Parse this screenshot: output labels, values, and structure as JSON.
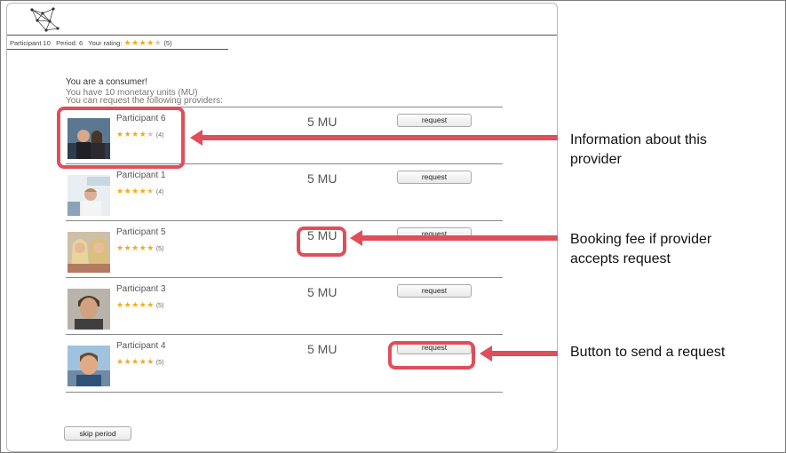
{
  "status": {
    "participant": "Participant 10",
    "period": "Period: 6",
    "rating_label": "Your rating:",
    "rating_stars": 4,
    "rating_count": "(5)"
  },
  "intro": {
    "line1": "You are a consumer!",
    "line2": "You have 10 monetary units (MU)",
    "line3": "You can request the following providers:"
  },
  "providers": [
    {
      "name": "Participant 6",
      "rating": 4,
      "count": "(4)",
      "price": "5 MU",
      "button": "request"
    },
    {
      "name": "Participant 1",
      "rating": 4.5,
      "count": "(4)",
      "price": "5 MU",
      "button": "request"
    },
    {
      "name": "Participant 5",
      "rating": 5,
      "count": "(5)",
      "price": "5 MU",
      "button": "request"
    },
    {
      "name": "Participant 3",
      "rating": 5,
      "count": "(5)",
      "price": "5 MU",
      "button": "request"
    },
    {
      "name": "Participant 4",
      "rating": 5,
      "count": "(5)",
      "price": "5 MU",
      "button": "request"
    }
  ],
  "skip_button": "skip period",
  "annotations": {
    "info": "Information about this\nprovider",
    "fee": "Booking fee if provider\naccepts request",
    "button": "Button to send a request"
  },
  "colors": {
    "highlight": "#e04e5a",
    "star": "#f0ad19"
  },
  "icons": [
    "network-logo-icon",
    "star-icon",
    "arrow-left-icon"
  ]
}
